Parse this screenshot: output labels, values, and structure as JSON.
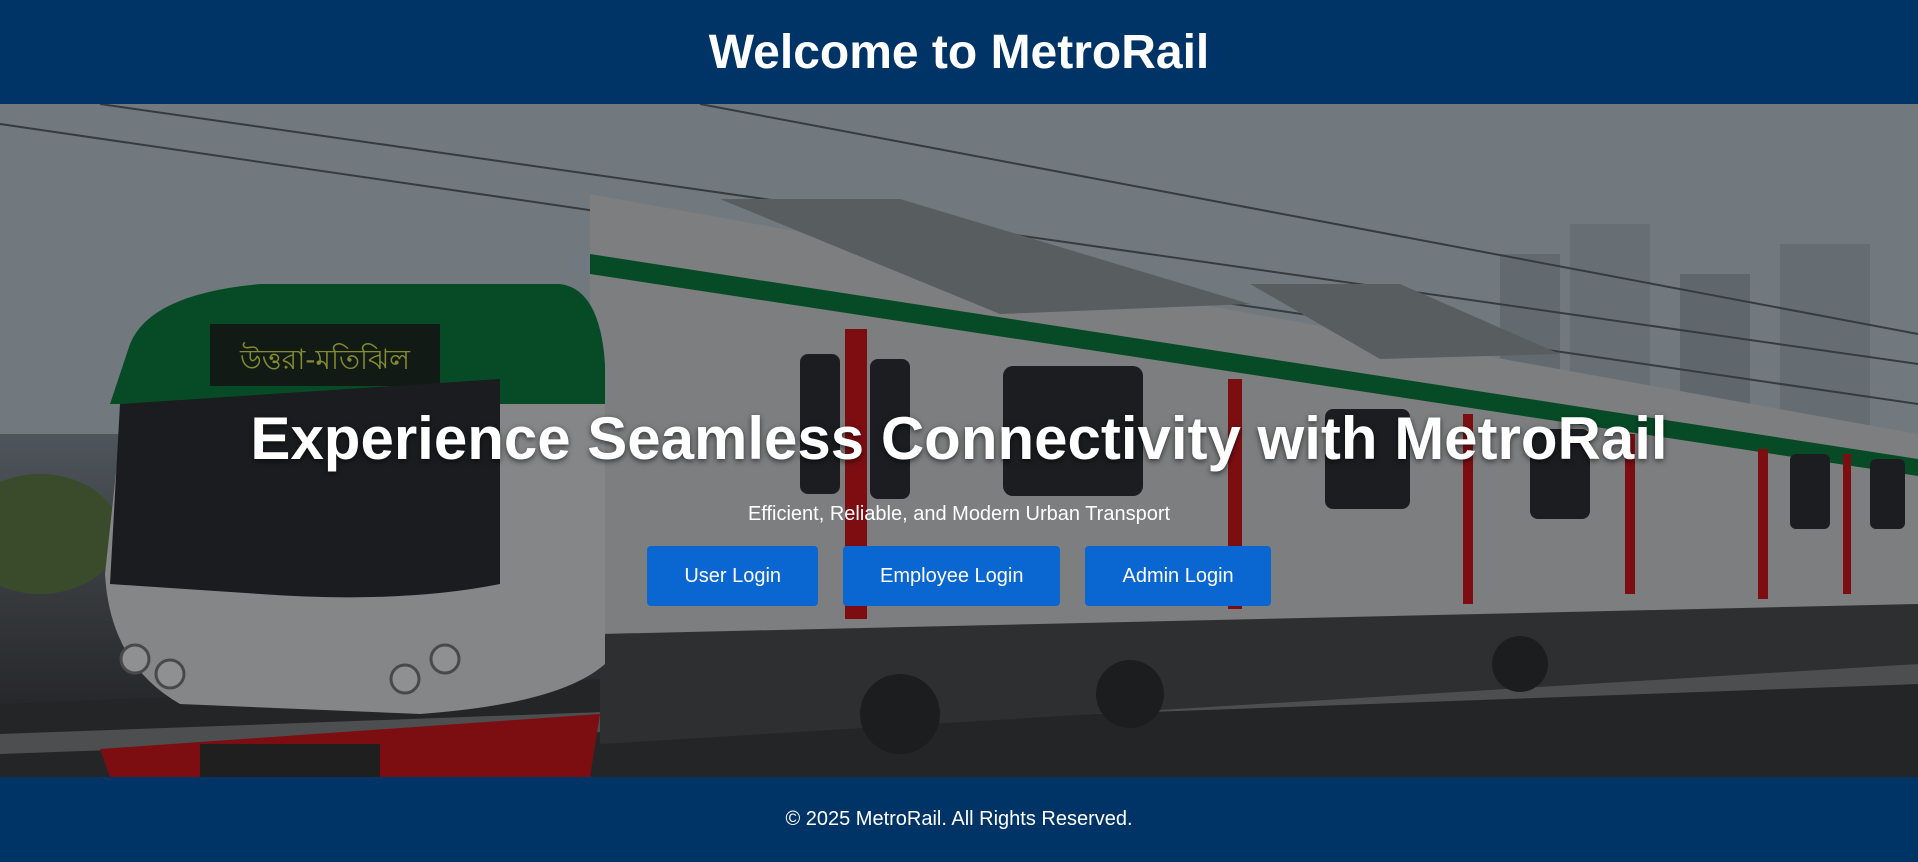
{
  "header": {
    "title": "Welcome to MetroRail"
  },
  "hero": {
    "title": "Experience Seamless Connectivity with MetroRail",
    "subtitle": "Efficient, Reliable, and Modern Urban Transport",
    "buttons": [
      {
        "label": "User Login"
      },
      {
        "label": "Employee Login"
      },
      {
        "label": "Admin Login"
      }
    ],
    "train_sign": "উত্তরা-মতিঝিল"
  },
  "footer": {
    "text": "© 2025 MetroRail. All Rights Reserved."
  },
  "colors": {
    "header_bg": "#003366",
    "button_bg": "#0a66d1",
    "train_green": "#0c7a3e",
    "train_red": "#c8181e"
  }
}
